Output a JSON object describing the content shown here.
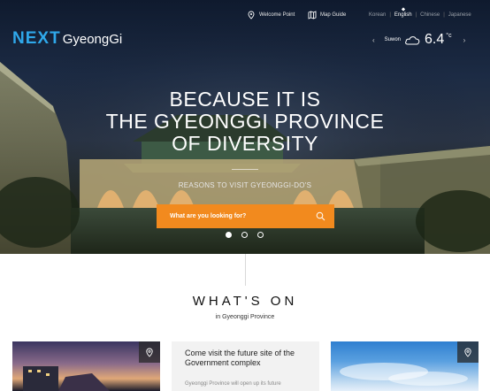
{
  "header": {
    "welcome_point": "Welcome Point",
    "map_guide": "Map Guide",
    "languages": [
      {
        "label": "Korean",
        "active": false
      },
      {
        "label": "English",
        "active": true
      },
      {
        "label": "Chinese",
        "active": false
      },
      {
        "label": "Japanese",
        "active": false
      }
    ],
    "lang_separator": "|",
    "logo_next": "NEXT",
    "logo_gyeonggi": "GyeongGi"
  },
  "weather": {
    "prev": "‹",
    "next": "›",
    "city": "Suwon",
    "temperature": "6.4",
    "unit": "°c",
    "icon": "cloud-icon"
  },
  "hero": {
    "headline": [
      "BECAUSE IT IS",
      "THE GYEONGGI PROVINCE",
      "OF DIVERSITY"
    ],
    "subline": "REASONS TO VISIT GYEONGGI-DO'S",
    "search_placeholder": "What are you looking for?",
    "slides": [
      true,
      false,
      false
    ]
  },
  "whats_on": {
    "title": "WHAT'S ON",
    "subtitle": "in Gyeonggi Province",
    "cards": [
      {
        "type": "image",
        "icon": "map-pin-icon"
      },
      {
        "type": "text",
        "title": "Come visit the future site of the Government complex",
        "desc": "Gyeonggi Province will open up its future"
      },
      {
        "type": "image",
        "icon": "map-pin-icon"
      }
    ]
  },
  "colors": {
    "accent": "#f28a1e",
    "logo_blue": "#2fa8ea"
  }
}
